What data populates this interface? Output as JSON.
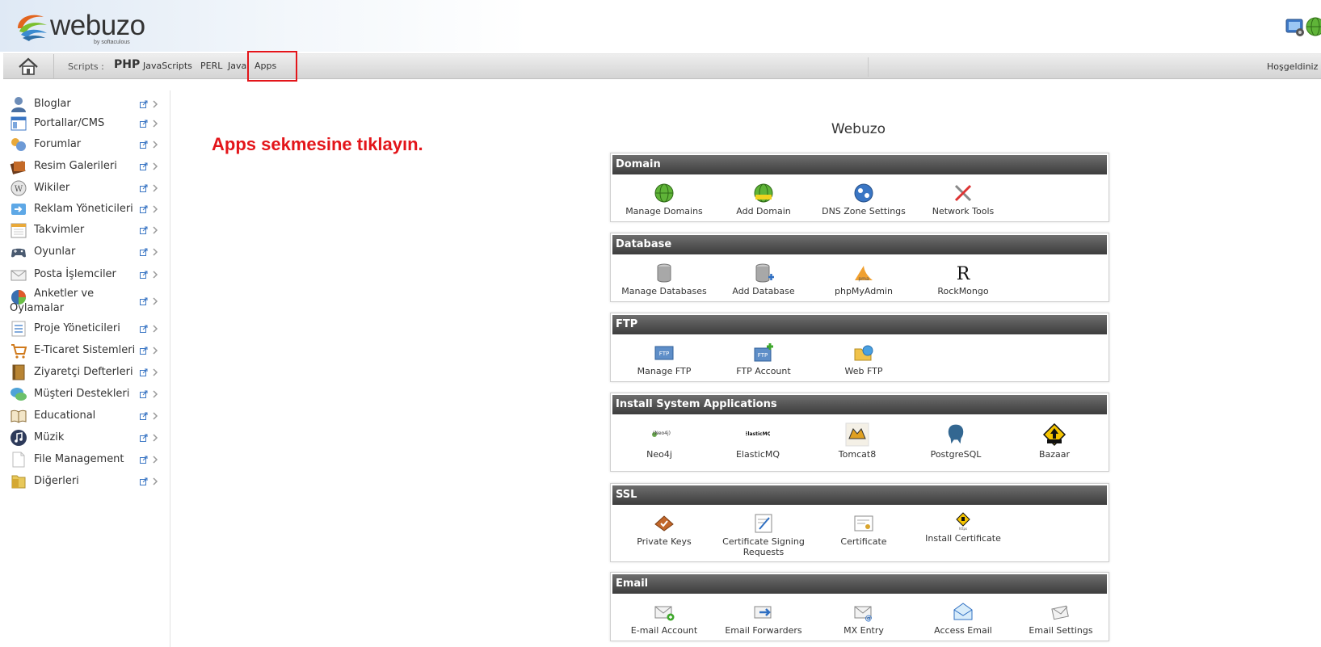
{
  "header": {
    "logo_text": "webuzo",
    "logo_sub": "by softaculous"
  },
  "navbar": {
    "scripts_label": "Scripts :",
    "links": [
      "PHP",
      "JavaScripts",
      "PERL",
      "Java",
      "Apps"
    ],
    "welcome": "Hoşgeldiniz t"
  },
  "sidebar": {
    "items": [
      {
        "label": "Bloglar",
        "icon": "user-icon"
      },
      {
        "label": "Portallar/CMS",
        "icon": "portal-icon"
      },
      {
        "label": "Forumlar",
        "icon": "forum-icon"
      },
      {
        "label": "Resim Galerileri",
        "icon": "gallery-icon"
      },
      {
        "label": "Wikiler",
        "icon": "wiki-icon"
      },
      {
        "label": "Reklam Yöneticileri",
        "icon": "ad-icon"
      },
      {
        "label": "Takvimler",
        "icon": "calendar-icon"
      },
      {
        "label": "Oyunlar",
        "icon": "gamepad-icon"
      },
      {
        "label": "Posta İşlemciler",
        "icon": "mail-icon"
      },
      {
        "label": "Anketler ve Oylamalar",
        "icon": "poll-icon"
      },
      {
        "label": "Proje Yöneticileri",
        "icon": "project-icon"
      },
      {
        "label": "E-Ticaret Sistemleri",
        "icon": "cart-icon"
      },
      {
        "label": "Ziyaretçi Defterleri",
        "icon": "guestbook-icon"
      },
      {
        "label": "Müşteri Destekleri",
        "icon": "support-icon"
      },
      {
        "label": "Educational",
        "icon": "book-icon"
      },
      {
        "label": "Müzik",
        "icon": "music-icon"
      },
      {
        "label": "File Management",
        "icon": "file-icon"
      },
      {
        "label": "Diğerleri",
        "icon": "folder-icon"
      }
    ]
  },
  "instruction": "Apps sekmesine tıklayın.",
  "main": {
    "title": "Webuzo",
    "panels": [
      {
        "title": "Domain",
        "tools": [
          {
            "label": "Manage Domains",
            "icon": "globe-icon"
          },
          {
            "label": "Add Domain",
            "icon": "globe-add-icon"
          },
          {
            "label": "DNS Zone Settings",
            "icon": "dns-icon"
          },
          {
            "label": "Network Tools",
            "icon": "tools-icon"
          }
        ]
      },
      {
        "title": "Database",
        "tools": [
          {
            "label": "Manage Databases",
            "icon": "database-icon"
          },
          {
            "label": "Add Database",
            "icon": "database-add-icon"
          },
          {
            "label": "phpMyAdmin",
            "icon": "phpmyadmin-icon"
          },
          {
            "label": "RockMongo",
            "icon": "rockmongo-icon"
          }
        ]
      },
      {
        "title": "FTP",
        "tools": [
          {
            "label": "Manage FTP",
            "icon": "ftp-icon"
          },
          {
            "label": "FTP Account",
            "icon": "ftp-account-icon"
          },
          {
            "label": "Web FTP",
            "icon": "web-ftp-icon"
          }
        ]
      },
      {
        "title": "Install System Applications",
        "tools": [
          {
            "label": "Neo4j",
            "icon": "neo4j-icon"
          },
          {
            "label": "ElasticMQ",
            "icon": "elasticmq-icon"
          },
          {
            "label": "Tomcat8",
            "icon": "tomcat-icon"
          },
          {
            "label": "PostgreSQL",
            "icon": "postgresql-icon"
          },
          {
            "label": "Bazaar",
            "icon": "bazaar-icon"
          }
        ]
      },
      {
        "title": "SSL",
        "tools": [
          {
            "label": "Private Keys",
            "icon": "key-icon"
          },
          {
            "label": "Certificate Signing Requests",
            "icon": "csr-icon"
          },
          {
            "label": "Certificate",
            "icon": "certificate-icon"
          },
          {
            "label": "Install Certificate",
            "icon": "install-cert-icon"
          }
        ]
      },
      {
        "title": "Email",
        "tools": [
          {
            "label": "E-mail Account",
            "icon": "email-account-icon"
          },
          {
            "label": "Email Forwarders",
            "icon": "email-forward-icon"
          },
          {
            "label": "MX Entry",
            "icon": "mx-icon"
          },
          {
            "label": "Access Email",
            "icon": "access-email-icon"
          },
          {
            "label": "Email Settings",
            "icon": "email-settings-icon"
          }
        ]
      }
    ]
  },
  "colors": {
    "accent_red": "#e3151a",
    "panel_header": "#4a4a4a"
  }
}
